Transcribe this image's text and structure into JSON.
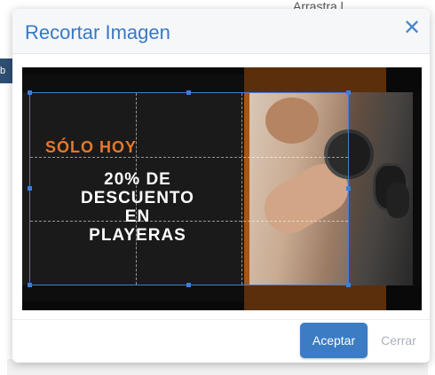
{
  "background": {
    "top_right_text": "Arrastra l",
    "left_bar_text": "b"
  },
  "dialog": {
    "title": "Recortar Imagen",
    "close_icon": "close-icon"
  },
  "image": {
    "promo_line1": "SÓLO HOY",
    "promo_line2": "20% DE",
    "promo_line3": "DESCUENTO",
    "promo_line4": "EN",
    "promo_line5": "PLAYERAS"
  },
  "footer": {
    "accept_label": "Aceptar",
    "close_label": "Cerrar"
  },
  "colors": {
    "accent": "#3b7cc4",
    "title": "#3779c4",
    "promo_orange": "#e4792c"
  }
}
